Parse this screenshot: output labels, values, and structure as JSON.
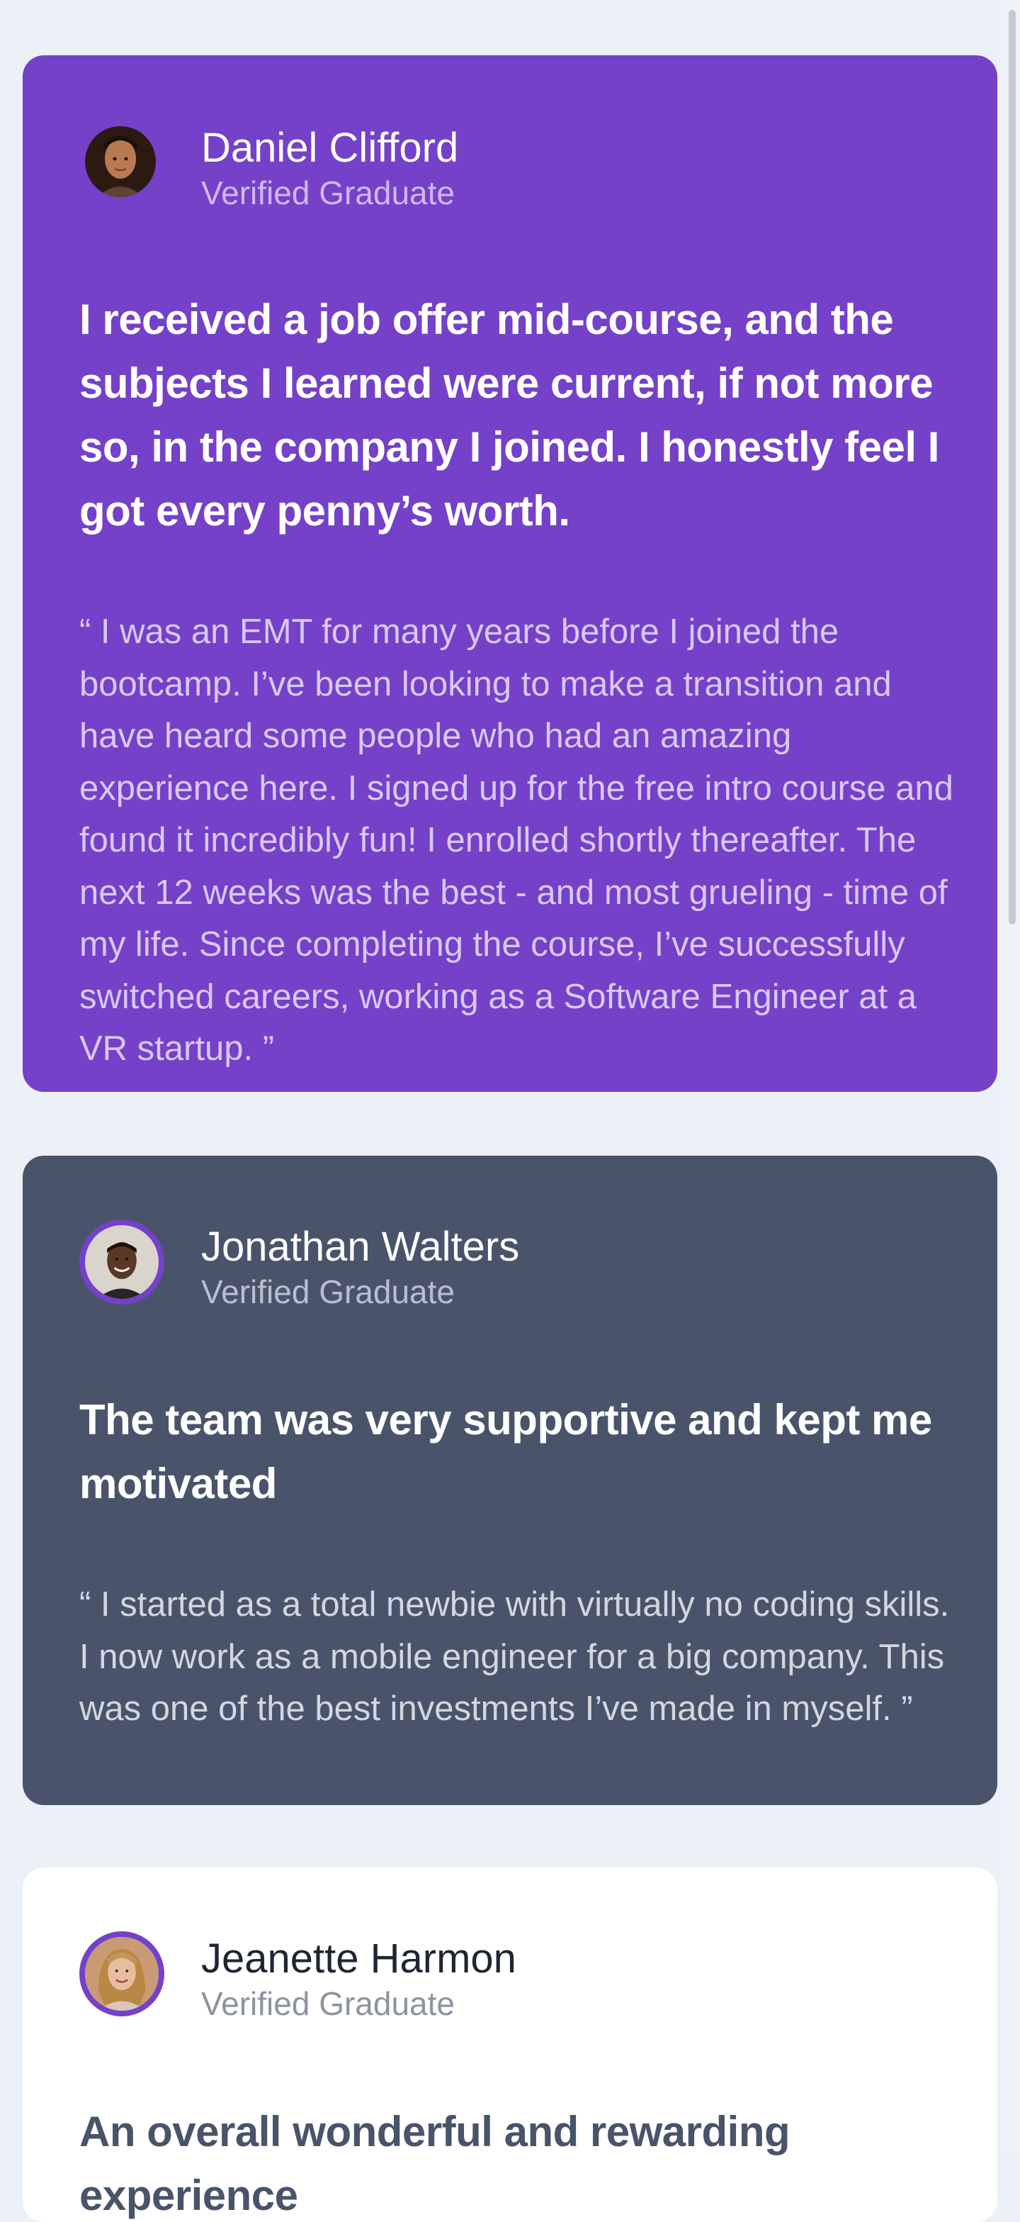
{
  "testimonials": [
    {
      "name": "Daniel Clifford",
      "role": "Verified Graduate",
      "headline": "I received a job offer mid-course, and the subjects I learned were current, if not more so, in the company I joined. I honestly feel I got every penny’s worth.",
      "quote": "“ I was an EMT for many years before I joined the bootcamp. I’ve been looking to make a transition and have heard some people who had an amazing experience here. I signed up for the free intro course and found it incredibly fun! I enrolled shortly thereafter. The next 12 weeks was the best - and most grueling - time of my life. Since completing the course, I’ve successfully switched careers, working as a Software Engineer at a VR startup. ”",
      "background": "#7441c8"
    },
    {
      "name": "Jonathan Walters",
      "role": "Verified Graduate",
      "headline": "The team was very supportive and kept me motivated",
      "quote": "“ I started as a total newbie with virtually no coding skills. I now work as a mobile engineer for a big company. This was one of the best investments I’ve made in myself. ”",
      "background": "#49546b"
    },
    {
      "name": "Jeanette Harmon",
      "role": "Verified Graduate",
      "headline": "An overall wonderful and rewarding experience",
      "background": "#ffffff"
    }
  ],
  "colors": {
    "page_background": "#ecf0f7",
    "accent_purple": "#7441c8",
    "dark_slate": "#49546b"
  },
  "icons": [
    "daniel-avatar",
    "jonathan-avatar",
    "jeanette-avatar"
  ]
}
